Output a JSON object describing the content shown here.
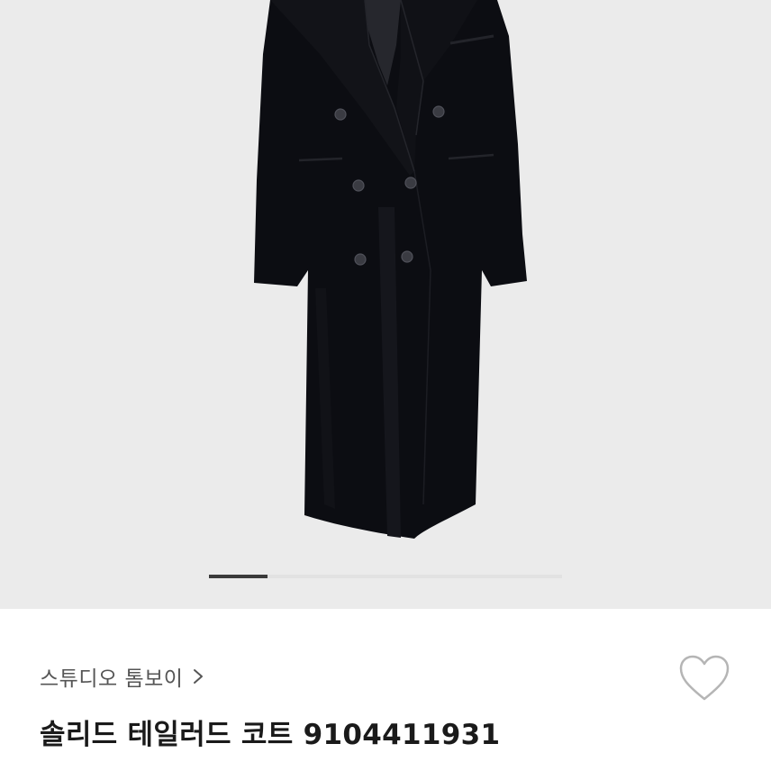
{
  "product": {
    "shop_name": "스튜디오 톰보이",
    "title": "솔리드 테일러드 코트 9104411931"
  },
  "gallery": {
    "current_image": 1,
    "total_images": 6
  },
  "icons": {
    "shop_chevron": "chevron-right-icon",
    "like": "heart-outline-icon"
  },
  "colors": {
    "image_background": "#ebebeb",
    "coat": "#0c0d12",
    "indicator_active": "#3a3a3a",
    "indicator_track": "#e2e2e2",
    "shop_name_text": "#555555",
    "title_text": "#1a1a1a"
  }
}
